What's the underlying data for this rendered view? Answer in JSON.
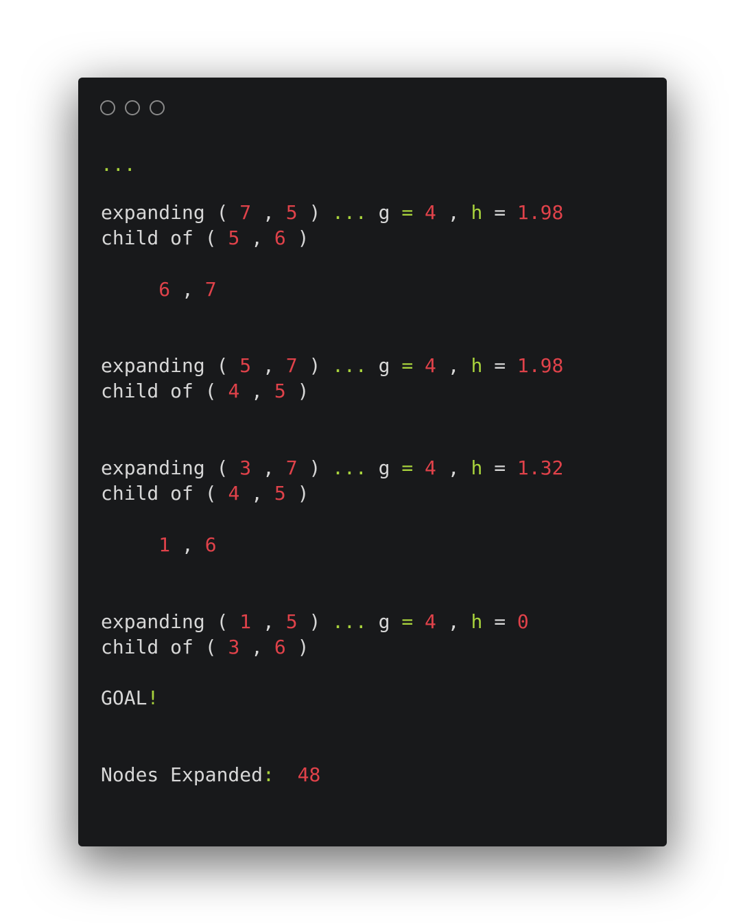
{
  "window": {
    "traffic_lights": [
      "close-circle-icon",
      "minimize-circle-icon",
      "maximize-circle-icon"
    ]
  },
  "colors": {
    "background": "#18191b",
    "text": "#d7d7d7",
    "number": "#e0424a",
    "operator": "#a8d23c"
  },
  "terminal": {
    "ellipsis": "...",
    "blocks": [
      {
        "expand_x": "7",
        "expand_y": "5",
        "g": "4",
        "h": "1.98",
        "parent_x": "5",
        "parent_y": "6",
        "extra_a": "6",
        "extra_b": "7"
      },
      {
        "expand_x": "5",
        "expand_y": "7",
        "g": "4",
        "h": "1.98",
        "parent_x": "4",
        "parent_y": "5"
      },
      {
        "expand_x": "3",
        "expand_y": "7",
        "g": "4",
        "h": "1.32",
        "parent_x": "4",
        "parent_y": "5",
        "extra_a": "1",
        "extra_b": "6"
      },
      {
        "expand_x": "1",
        "expand_y": "5",
        "g": "4",
        "h": "0",
        "parent_x": "3",
        "parent_y": "6"
      }
    ],
    "labels": {
      "expanding": "expanding",
      "child_of": "child of",
      "g": "g",
      "h": "h",
      "goal": "GOAL",
      "goal_mark": "!",
      "nodes_expanded": "Nodes Expanded",
      "colon": ":"
    },
    "nodes_expanded_value": "48"
  }
}
